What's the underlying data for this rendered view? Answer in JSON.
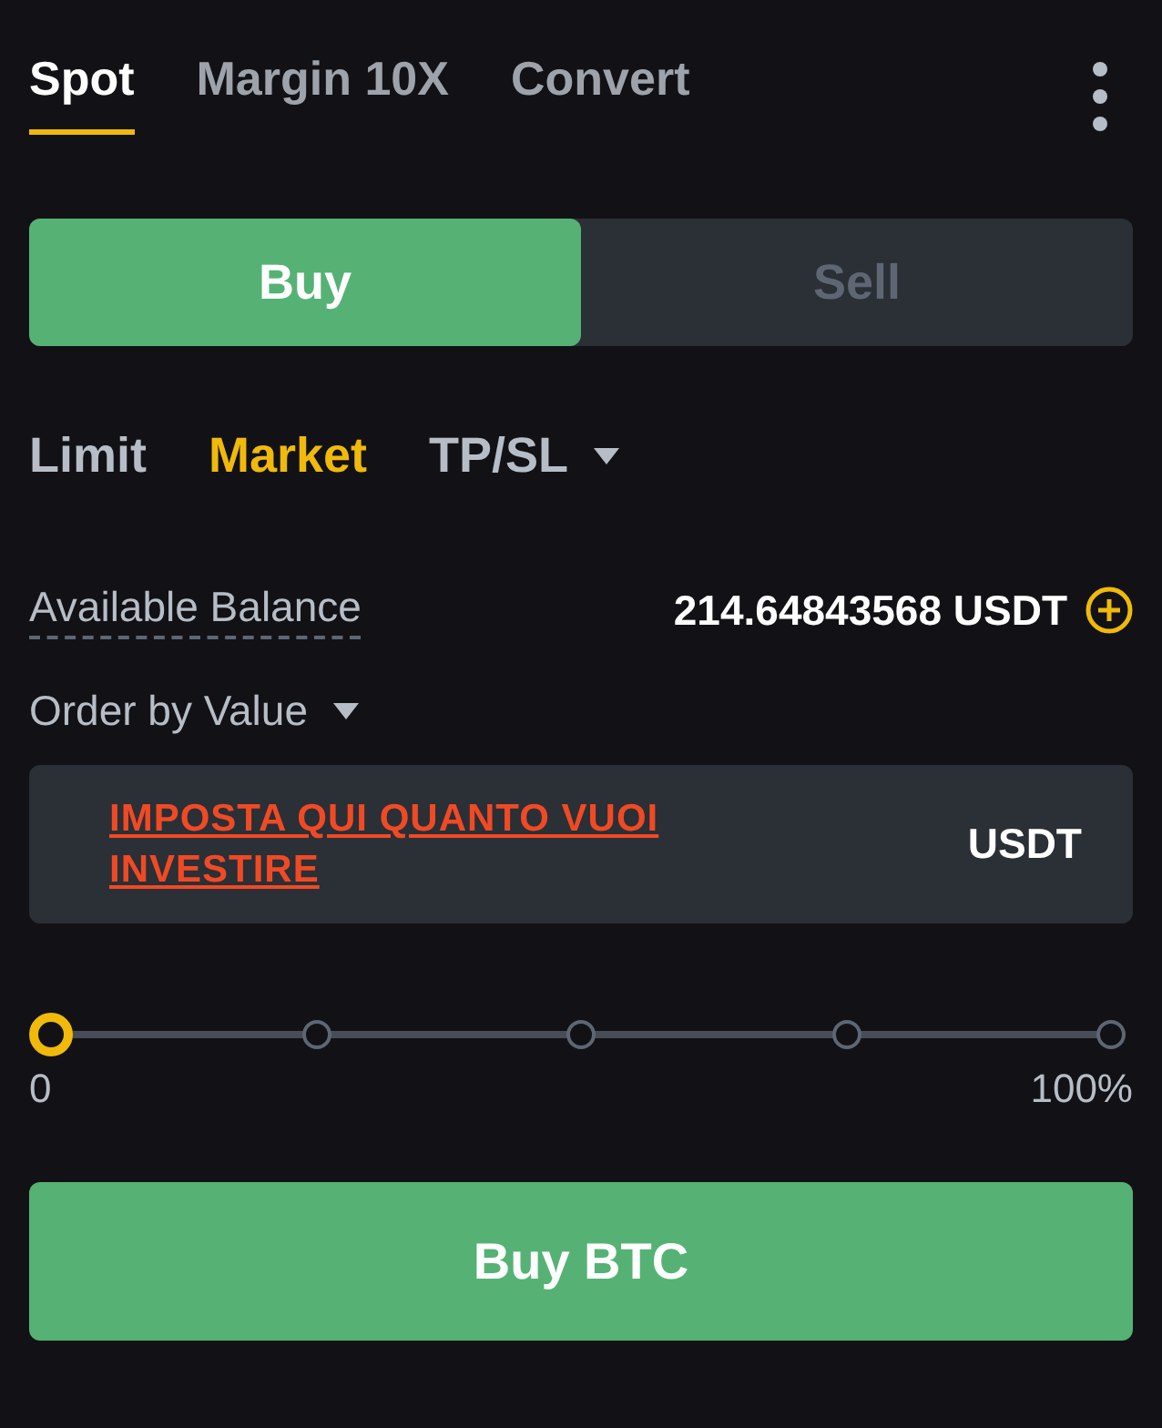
{
  "tabs": [
    {
      "label": "Spot",
      "selected": true
    },
    {
      "label": "Margin 10X",
      "selected": false
    },
    {
      "label": "Convert",
      "selected": false
    }
  ],
  "side": [
    {
      "label": "Buy",
      "selected": true
    },
    {
      "label": "Sell",
      "selected": false
    }
  ],
  "order_types": [
    {
      "label": "Limit",
      "selected": false,
      "dropdown": false
    },
    {
      "label": "Market",
      "selected": true,
      "dropdown": false
    },
    {
      "label": "TP/SL",
      "selected": false,
      "dropdown": true
    }
  ],
  "balance": {
    "label": "Available Balance",
    "value": "214.64843568 USDT"
  },
  "order_mode": {
    "label": "Order by Value"
  },
  "amount_field": {
    "value": "IMPOSTA QUI QUANTO VUOI INVESTIRE",
    "unit": "USDT"
  },
  "slider": {
    "level": 0,
    "min_label": "0",
    "max_label": "100%"
  },
  "submit": "Buy BTC"
}
